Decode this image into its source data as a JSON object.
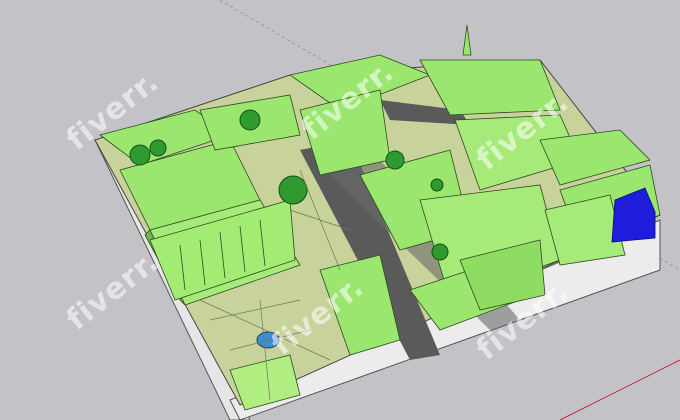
{
  "watermark": {
    "text": "fiverr.",
    "color": "#ffffff"
  },
  "scene": {
    "description_colors": {
      "background": "#c3c3c7",
      "building": "#9be66e",
      "building_shadow": "#6fb84a",
      "ground": "#c7d39a",
      "road": "#5a5a5a",
      "base_side": "#e8e8e8",
      "tree": "#2f9a2f",
      "highlight_block": "#1d1ddb",
      "water": "#3a8fd6"
    }
  }
}
